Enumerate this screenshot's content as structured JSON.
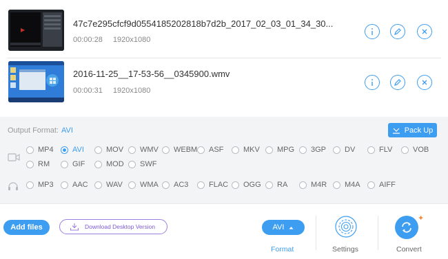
{
  "files": [
    {
      "name": "47c7e295cfcf9d0554185202818b7d2b_2017_02_03_01_34_30...",
      "duration": "00:00:28",
      "resolution": "1920x1080"
    },
    {
      "name": "2016-11-25__17-53-56__0345900.wmv",
      "duration": "00:00:31",
      "resolution": "1920x1080"
    }
  ],
  "file_actions": {
    "info_icon": "info-icon",
    "edit_icon": "pencil-icon",
    "remove_icon": "close-icon"
  },
  "output": {
    "label": "Output Format:",
    "current": "AVI",
    "pack_up": "Pack Up"
  },
  "video_formats": [
    "MP4",
    "AVI",
    "MOV",
    "WMV",
    "WEBM",
    "ASF",
    "MKV",
    "MPG",
    "3GP",
    "DV",
    "FLV",
    "VOB",
    "RM",
    "GIF",
    "MOD",
    "SWF"
  ],
  "audio_formats": [
    "MP3",
    "AAC",
    "WAV",
    "WMA",
    "AC3",
    "FLAC",
    "OGG",
    "RA",
    "M4R",
    "M4A",
    "AIFF"
  ],
  "selected_format": "AVI",
  "bottom": {
    "add_files": "Add files",
    "download": "Download Desktop Version",
    "format_button": "AVI",
    "format_label": "Format",
    "settings_label": "Settings",
    "convert_label": "Convert"
  },
  "colors": {
    "accent": "#3d9df0",
    "purple": "#7c5ad6",
    "spark": "#f08a3c"
  }
}
